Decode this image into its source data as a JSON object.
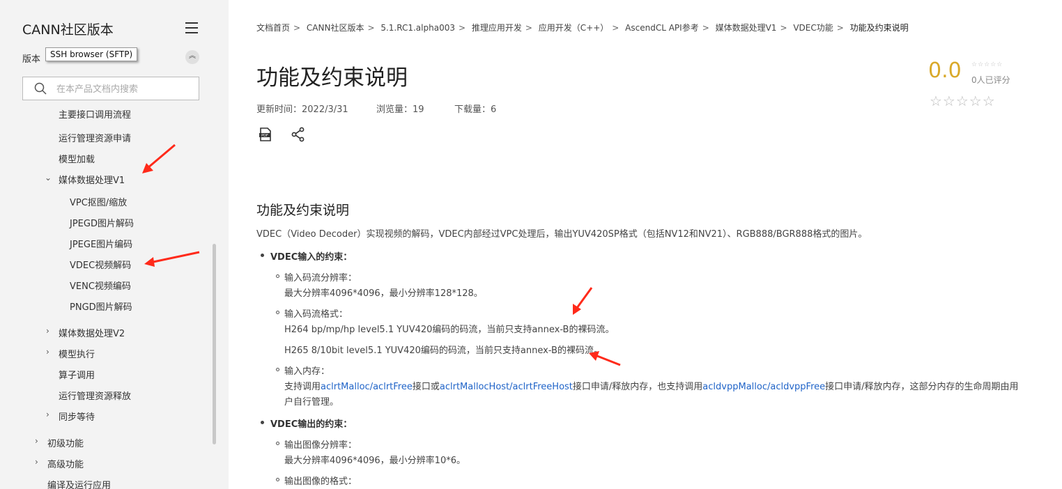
{
  "sidebar": {
    "title": "CANN社区版本",
    "version_label": "版本",
    "tooltip": "SSH browser (SFTP)",
    "collapse_glyph": "︽",
    "search_placeholder": "在本产品文档内搜索",
    "partial_item": "主要接口调用流程",
    "items": [
      "运行管理资源申请",
      "模型加载",
      "媒体数据处理V1",
      "VPC抠图/缩放",
      "JPEGD图片解码",
      "JPEGE图片编码",
      "VDEC视频解码",
      "VENC视频编码",
      "PNGD图片解码",
      "媒体数据处理V2",
      "模型执行",
      "算子调用",
      "运行管理资源释放",
      "同步等待",
      "初级功能",
      "高级功能",
      "编译及运行应用"
    ]
  },
  "breadcrumb": {
    "separator": ">",
    "items": [
      "文档首页",
      "CANN社区版本",
      "5.1.RC1.alpha003",
      "推理应用开发",
      "应用开发（C++）",
      "AscendCL API参考",
      "媒体数据处理V1",
      "VDEC功能"
    ],
    "current": "功能及约束说明"
  },
  "doc": {
    "title": "功能及约束说明",
    "updated": "更新时间：2022/3/31",
    "views": "浏览量：19",
    "downloads": "下载量：6"
  },
  "rating": {
    "score": "0.0",
    "mini_stars": "☆☆☆☆☆",
    "count_text": "0人已评分",
    "stars": "☆☆☆☆☆"
  },
  "content": {
    "heading": "功能及约束说明",
    "intro": "VDEC（Video Decoder）实现视频的解码，VDEC内部经过VPC处理后，输出YUV420SP格式（包括NV12和NV21）、RGB888/BGR888格式的图片。",
    "input_title": "VDEC输入的约束：",
    "res_label": "输入码流分辨率：",
    "res_value": "最大分辨率4096*4096，最小分辨率128*128。",
    "fmt_label": "输入码流格式：",
    "fmt_h264": "H264 bp/mp/hp level5.1 YUV420编码的码流，当前只支持annex-B的裸码流。",
    "fmt_h265": "H265 8/10bit level5.1 YUV420编码的码流，当前只支持annex-B的裸码流。",
    "mem_label": "输入内存：",
    "mem_p1": "支持调用",
    "mem_l1": "aclrtMalloc",
    "mem_s1": "/",
    "mem_l2": "aclrtFree",
    "mem_p2": "接口或",
    "mem_l3": "aclrtMallocHost",
    "mem_s2": "/",
    "mem_l4": "aclrtFreeHost",
    "mem_p3": "接口申请/释放内存，也支持调用",
    "mem_l5": "acldvppMalloc",
    "mem_s3": "/",
    "mem_l6": "acldvppFree",
    "mem_p4": "接口申请/释放内存，这部分内存的生命周期由用",
    "mem_cont": "户自行管理。",
    "output_title": "VDEC输出的约束：",
    "out_res_label": "输出图像分辨率：",
    "out_res_value": "最大分辨率4096*4096，最小分辨率10*6。",
    "out_fmt_label": "输出图像的格式："
  },
  "colors": {
    "sidebar_bg": "#f3f3f3",
    "link": "#2064c8",
    "score": "#d9a92a",
    "arrow": "#ff2a1a"
  }
}
